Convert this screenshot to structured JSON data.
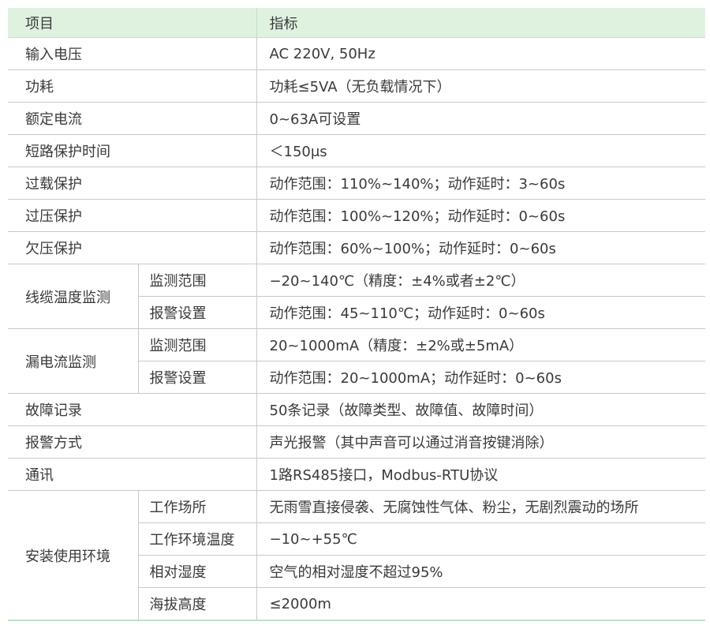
{
  "header": {
    "item": "项目",
    "spec": "指标"
  },
  "rows": {
    "r1": {
      "item": "输入电压",
      "value": "AC 220V, 50Hz"
    },
    "r2": {
      "item": "功耗",
      "value": "功耗≤5VA（无负载情况下）"
    },
    "r3": {
      "item": "额定电流",
      "value": "0~63A可设置"
    },
    "r4": {
      "item": "短路保护时间",
      "value": "＜150μs"
    },
    "r5": {
      "item": "过载保护",
      "value": "动作范围：110%~140%；动作延时：3~60s"
    },
    "r6": {
      "item": "过压保护",
      "value": "动作范围：100%~120%；动作延时：0~60s"
    },
    "r7": {
      "item": "欠压保护",
      "value": "动作范围：60%~100%；动作延时：0~60s"
    },
    "r8": {
      "item": "线缆温度监测",
      "sub1": {
        "label": "监测范围",
        "value": "−20~140℃（精度：±4%或者±2℃）"
      },
      "sub2": {
        "label": "报警设置",
        "value": "动作范围：45~110℃；动作延时：0~60s"
      }
    },
    "r9": {
      "item": "漏电流监测",
      "sub1": {
        "label": "监测范围",
        "value": "20~1000mA（精度：±2%或±5mA）"
      },
      "sub2": {
        "label": "报警设置",
        "value": "动作范围：20~1000mA；动作延时：0~60s"
      }
    },
    "r10": {
      "item": "故障记录",
      "value": "50条记录（故障类型、故障值、故障时间）"
    },
    "r11": {
      "item": "报警方式",
      "value": "声光报警（其中声音可以通过消音按键消除）"
    },
    "r12": {
      "item": "通讯",
      "value": "1路RS485接口，Modbus-RTU协议"
    },
    "r13": {
      "item": "安装使用环境",
      "sub1": {
        "label": "工作场所",
        "value": "无雨雪直接侵袭、无腐蚀性气体、粉尘，无剧烈震动的场所"
      },
      "sub2": {
        "label": "工作环境温度",
        "value": "−10~+55℃"
      },
      "sub3": {
        "label": "相对湿度",
        "value": "空气的相对湿度不超过95%"
      },
      "sub4": {
        "label": "海拔高度",
        "value": "≤2000m"
      }
    }
  },
  "colors": {
    "header_bg": "#dff2e0",
    "border": "#c9c9c9",
    "text": "#3a3a3a"
  }
}
